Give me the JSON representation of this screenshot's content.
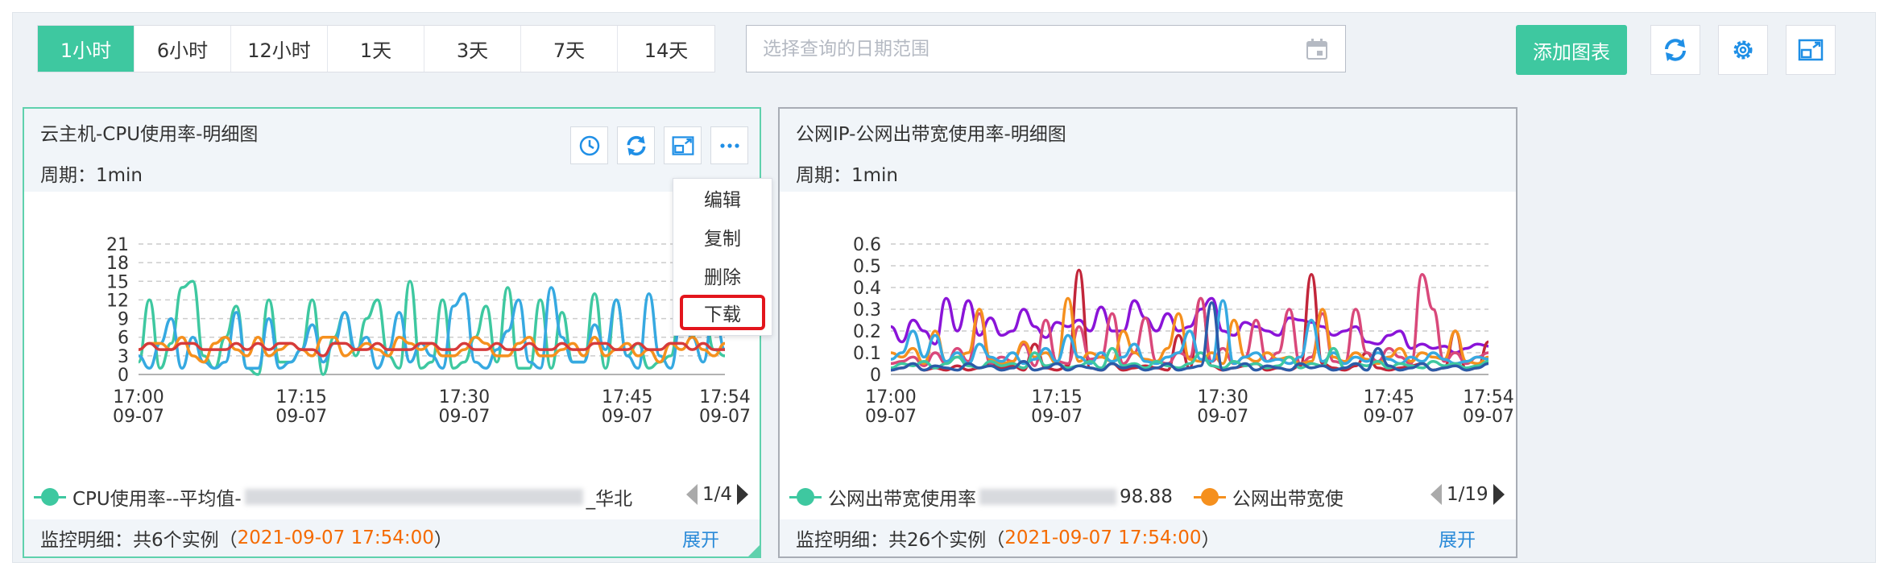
{
  "toolbar": {
    "time_tabs": [
      "1小时",
      "6小时",
      "12小时",
      "1天",
      "3天",
      "7天",
      "14天"
    ],
    "active_tab": "1小时",
    "date_placeholder": "选择查询的日期范围",
    "add_chart_label": "添加图表",
    "accent": "#3ec8a0"
  },
  "panels": [
    {
      "title": "云主机-CPU使用率-明细图",
      "period": "周期：1min",
      "legend": {
        "first": "CPU使用率--平均值-",
        "tail": "_华北",
        "page": "1/4"
      },
      "footer": {
        "prefix": "监控明细：共6个实例（",
        "timestamp": "2021-09-07 17:54:00",
        "suffix": "）",
        "expand": "展开"
      },
      "menu": [
        "编辑",
        "复制",
        "删除",
        "下载"
      ],
      "highlighted_menu_item": "下载"
    },
    {
      "title": "公网IP-公网出带宽使用率-明细图",
      "period": "周期：1min",
      "legend": {
        "first": "公网出带宽使用率",
        "first_value": "98.88",
        "second": "公网出带宽使",
        "page": "1/19"
      },
      "footer": {
        "prefix": "监控明细：共26个实例（",
        "timestamp": "2021-09-07 17:54:00",
        "suffix": "）",
        "expand": "展开"
      }
    }
  ],
  "chart_data": [
    {
      "type": "line",
      "yticks": [
        "0",
        "3",
        "6",
        "9",
        "12",
        "15",
        "18",
        "21"
      ],
      "ylim": [
        0,
        21
      ],
      "xticks": [
        {
          "time": "17:00",
          "date": "09-07"
        },
        {
          "time": "17:15",
          "date": "09-07"
        },
        {
          "time": "17:30",
          "date": "09-07"
        },
        {
          "time": "17:45",
          "date": "09-07"
        },
        {
          "time": "17:54",
          "date": "09-07"
        }
      ],
      "x_minutes": [
        0,
        15,
        30,
        45,
        54
      ],
      "grid": "dashed horizontal",
      "series": [
        {
          "color": "#3ec8a0",
          "values": [
            2,
            12,
            1,
            5,
            14,
            15,
            3,
            1,
            6,
            11,
            1,
            0,
            12,
            2,
            2,
            4,
            12,
            0,
            6,
            10,
            3,
            9,
            12,
            3,
            1,
            15,
            1,
            2,
            12,
            1,
            2,
            6,
            11,
            2,
            14,
            1,
            1,
            12,
            1,
            10,
            2,
            2,
            13,
            1,
            12,
            3,
            5,
            1,
            2,
            3,
            12,
            6,
            11,
            4,
            3
          ]
        },
        {
          "color": "#36a9e1",
          "values": [
            3,
            1,
            5,
            9,
            1,
            6,
            2,
            1,
            2,
            10,
            1,
            1,
            9,
            1,
            2,
            4,
            8,
            2,
            5,
            10,
            4,
            6,
            1,
            4,
            10,
            2,
            5,
            3,
            1,
            11,
            13,
            2,
            1,
            4,
            7,
            12,
            2,
            1,
            14,
            6,
            2,
            2,
            8,
            4,
            12,
            3,
            1,
            13,
            3,
            1,
            9,
            6,
            2,
            11,
            4
          ]
        },
        {
          "color": "#f5901e",
          "values": [
            4,
            5,
            5,
            4,
            6,
            3,
            2,
            5,
            6,
            4,
            3,
            6,
            3,
            4,
            5,
            4,
            3,
            6,
            6,
            3,
            4,
            5,
            4,
            3,
            6,
            5,
            4,
            5,
            3,
            3,
            4,
            6,
            5,
            3,
            3,
            5,
            6,
            3,
            3,
            4,
            5,
            3,
            6,
            3,
            4,
            5,
            3,
            4,
            2,
            5,
            4,
            6,
            4,
            3,
            5
          ]
        },
        {
          "color": "#d63b3b",
          "values": [
            4,
            5,
            4,
            4,
            5,
            5,
            4,
            4,
            4,
            5,
            4,
            5,
            4,
            5,
            5,
            4,
            4,
            3,
            5,
            5,
            4,
            4,
            5,
            4,
            4,
            4,
            5,
            5,
            4,
            4,
            5,
            4,
            4,
            5,
            4,
            4,
            5,
            4,
            4,
            5,
            4,
            4,
            5,
            5,
            4,
            4,
            5,
            4,
            4,
            5,
            5,
            4,
            5,
            4,
            4
          ]
        }
      ]
    },
    {
      "type": "line",
      "yticks": [
        "0",
        "0.1",
        "0.2",
        "0.3",
        "0.4",
        "0.5",
        "0.6"
      ],
      "ylim": [
        0,
        0.6
      ],
      "xticks": [
        {
          "time": "17:00",
          "date": "09-07"
        },
        {
          "time": "17:15",
          "date": "09-07"
        },
        {
          "time": "17:30",
          "date": "09-07"
        },
        {
          "time": "17:45",
          "date": "09-07"
        },
        {
          "time": "17:54",
          "date": "09-07"
        }
      ],
      "x_minutes": [
        0,
        15,
        30,
        45,
        54
      ],
      "grid": "dashed horizontal",
      "series": [
        {
          "color": "#8a14d8",
          "values": [
            0.22,
            0.15,
            0.25,
            0.2,
            0.14,
            0.35,
            0.2,
            0.34,
            0.18,
            0.26,
            0.18,
            0.2,
            0.3,
            0.22,
            0.17,
            0.24,
            0.22,
            0.25,
            0.2,
            0.31,
            0.2,
            0.2,
            0.34,
            0.26,
            0.2,
            0.28,
            0.2,
            0.22,
            0.3,
            0.35,
            0.2,
            0.18,
            0.24,
            0.22,
            0.2,
            0.18,
            0.26,
            0.25,
            0.24,
            0.22,
            0.18,
            0.2,
            0.22,
            0.15,
            0.14,
            0.18,
            0.2,
            0.12,
            0.14,
            0.12,
            0.13,
            0.1,
            0.12,
            0.14,
            0.13
          ]
        },
        {
          "color": "#c2263a",
          "values": [
            0.02,
            0.03,
            0.05,
            0.02,
            0.03,
            0.02,
            0.04,
            0.02,
            0.03,
            0.05,
            0.03,
            0.04,
            0.02,
            0.14,
            0.03,
            0.02,
            0.04,
            0.48,
            0.03,
            0.02,
            0.05,
            0.02,
            0.03,
            0.04,
            0.03,
            0.02,
            0.18,
            0.03,
            0.35,
            0.04,
            0.02,
            0.03,
            0.04,
            0.05,
            0.02,
            0.03,
            0.02,
            0.04,
            0.46,
            0.05,
            0.03,
            0.02,
            0.04,
            0.1,
            0.03,
            0.02,
            0.03,
            0.04,
            0.05,
            0.02,
            0.03,
            0.2,
            0.02,
            0.03,
            0.15
          ]
        },
        {
          "color": "#d9487a",
          "values": [
            0.05,
            0.06,
            0.08,
            0.04,
            0.1,
            0.05,
            0.12,
            0.06,
            0.28,
            0.05,
            0.08,
            0.06,
            0.14,
            0.04,
            0.25,
            0.06,
            0.05,
            0.22,
            0.07,
            0.08,
            0.28,
            0.05,
            0.1,
            0.26,
            0.06,
            0.05,
            0.1,
            0.08,
            0.35,
            0.06,
            0.12,
            0.05,
            0.08,
            0.25,
            0.06,
            0.1,
            0.3,
            0.05,
            0.08,
            0.28,
            0.06,
            0.05,
            0.3,
            0.1,
            0.06,
            0.12,
            0.08,
            0.05,
            0.46,
            0.3,
            0.06,
            0.1,
            0.05,
            0.08,
            0.1
          ]
        },
        {
          "color": "#f5901e",
          "values": [
            0.1,
            0.08,
            0.12,
            0.05,
            0.2,
            0.06,
            0.08,
            0.1,
            0.3,
            0.07,
            0.05,
            0.06,
            0.15,
            0.08,
            0.1,
            0.05,
            0.35,
            0.06,
            0.1,
            0.08,
            0.06,
            0.2,
            0.1,
            0.07,
            0.06,
            0.12,
            0.28,
            0.07,
            0.06,
            0.1,
            0.05,
            0.25,
            0.08,
            0.06,
            0.1,
            0.07,
            0.08,
            0.05,
            0.06,
            0.3,
            0.08,
            0.06,
            0.1,
            0.07,
            0.05,
            0.08,
            0.12,
            0.06,
            0.1,
            0.08,
            0.07,
            0.2,
            0.06,
            0.05,
            0.08
          ]
        },
        {
          "color": "#36a9e1",
          "values": [
            0.07,
            0.1,
            0.2,
            0.08,
            0.18,
            0.06,
            0.1,
            0.05,
            0.14,
            0.08,
            0.06,
            0.1,
            0.05,
            0.07,
            0.12,
            0.06,
            0.18,
            0.08,
            0.05,
            0.1,
            0.06,
            0.08,
            0.14,
            0.06,
            0.05,
            0.08,
            0.1,
            0.2,
            0.07,
            0.06,
            0.34,
            0.05,
            0.08,
            0.1,
            0.06,
            0.07,
            0.05,
            0.08,
            0.25,
            0.06,
            0.1,
            0.05,
            0.08,
            0.06,
            0.1,
            0.07,
            0.05,
            0.08,
            0.06,
            0.1,
            0.07,
            0.05,
            0.06,
            0.08,
            0.07
          ]
        },
        {
          "color": "#3ec8a0",
          "values": [
            0.03,
            0.05,
            0.04,
            0.06,
            0.03,
            0.05,
            0.08,
            0.04,
            0.03,
            0.06,
            0.04,
            0.05,
            0.03,
            0.1,
            0.04,
            0.05,
            0.03,
            0.04,
            0.06,
            0.03,
            0.12,
            0.04,
            0.05,
            0.03,
            0.06,
            0.04,
            0.03,
            0.05,
            0.1,
            0.04,
            0.03,
            0.06,
            0.04,
            0.05,
            0.03,
            0.04,
            0.08,
            0.03,
            0.05,
            0.04,
            0.12,
            0.03,
            0.05,
            0.04,
            0.06,
            0.03,
            0.05,
            0.04,
            0.03,
            0.06,
            0.04,
            0.05,
            0.03,
            0.04,
            0.06
          ]
        },
        {
          "color": "#2b5ba8",
          "values": [
            0.02,
            0.03,
            0.05,
            0.02,
            0.04,
            0.03,
            0.02,
            0.05,
            0.03,
            0.04,
            0.02,
            0.03,
            0.06,
            0.02,
            0.03,
            0.05,
            0.02,
            0.04,
            0.03,
            0.02,
            0.05,
            0.03,
            0.04,
            0.02,
            0.03,
            0.05,
            0.02,
            0.03,
            0.04,
            0.33,
            0.02,
            0.03,
            0.05,
            0.02,
            0.04,
            0.03,
            0.02,
            0.05,
            0.03,
            0.04,
            0.02,
            0.03,
            0.05,
            0.02,
            0.12,
            0.04,
            0.02,
            0.03,
            0.05,
            0.02,
            0.03,
            0.04,
            0.02,
            0.03,
            0.05
          ]
        }
      ]
    }
  ]
}
